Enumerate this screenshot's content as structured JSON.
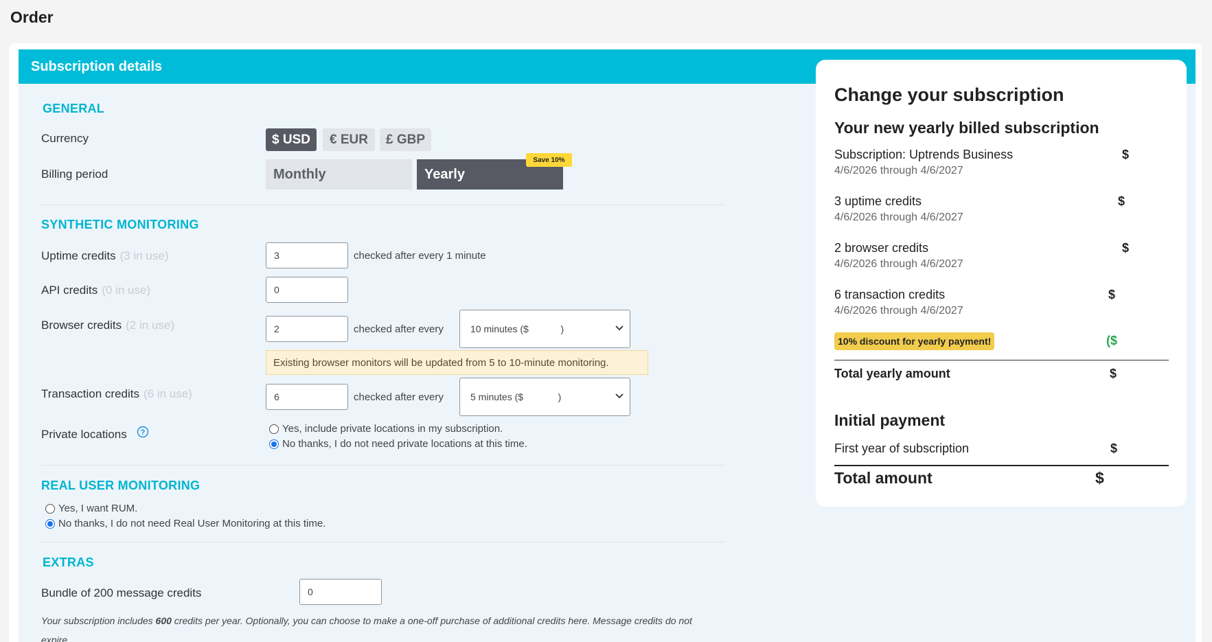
{
  "page": {
    "title": "Order"
  },
  "panel": {
    "header": "Subscription details"
  },
  "general": {
    "title": "GENERAL",
    "currency_label": "Currency",
    "currencies": [
      "$ USD",
      "€ EUR",
      "£ GBP"
    ],
    "selected_currency": "$ USD",
    "billing_label": "Billing period",
    "billing_options": [
      "Monthly",
      "Yearly"
    ],
    "selected_billing": "Yearly",
    "save_badge": "Save 10%"
  },
  "synthetic": {
    "title": "SYNTHETIC MONITORING",
    "uptime": {
      "label": "Uptime credits",
      "in_use": "(3 in use)",
      "value": "3",
      "after": "checked after every 1 minute"
    },
    "api": {
      "label": "API credits",
      "in_use": "(0 in use)",
      "value": "0"
    },
    "browser": {
      "label": "Browser credits",
      "in_use": "(2 in use)",
      "value": "2",
      "after": "checked after every",
      "select": "10 minutes ($            )"
    },
    "warning": "Existing browser monitors will be updated from 5 to 10-minute monitoring.",
    "transaction": {
      "label": "Transaction credits",
      "in_use": "(6 in use)",
      "value": "6",
      "after": "checked after every",
      "select": "5 minutes ($             )"
    },
    "private": {
      "label": "Private locations",
      "options": [
        "Yes, include private locations in my subscription.",
        "No thanks, I do not need private locations at this time."
      ],
      "selected": 1
    }
  },
  "rum": {
    "title": "REAL USER MONITORING",
    "options": [
      "Yes, I want RUM.",
      "No thanks, I do not need Real User Monitoring at this time."
    ],
    "selected": 1
  },
  "extras": {
    "title": "EXTRAS",
    "bundle_label": "Bundle of 200 message credits",
    "bundle_value": "0",
    "note_pre": "Your subscription includes ",
    "note_bold": "600",
    "note_post": " credits per year. Optionally, you can choose to make a one-off purchase of additional credits here. Message credits do not expire."
  },
  "summary": {
    "title": "Change your subscription",
    "subtitle": "Your new yearly billed subscription",
    "items": [
      {
        "title": "Subscription: Uptrends Business",
        "dates": "4/6/2026 through 4/6/2027",
        "price": "$"
      },
      {
        "title": "3 uptime credits",
        "dates": "4/6/2026 through 4/6/2027",
        "price": "$"
      },
      {
        "title": "2 browser credits",
        "dates": "4/6/2026 through 4/6/2027",
        "price": "$"
      },
      {
        "title": "6 transaction credits",
        "dates": "4/6/2026 through 4/6/2027",
        "price": "$"
      }
    ],
    "discount_label": "10% discount for yearly payment!",
    "discount_price": "($",
    "total_yearly_label": "Total yearly amount",
    "total_yearly_price": "$",
    "initial_title": "Initial payment",
    "first_year_label": "First year of subscription",
    "first_year_price": "$",
    "total_label": "Total amount",
    "total_price": "$"
  },
  "colors": {
    "accent": "#00bcd8",
    "active": "#575a63",
    "discount": "#f2cc4c",
    "green": "#2aa64a"
  }
}
